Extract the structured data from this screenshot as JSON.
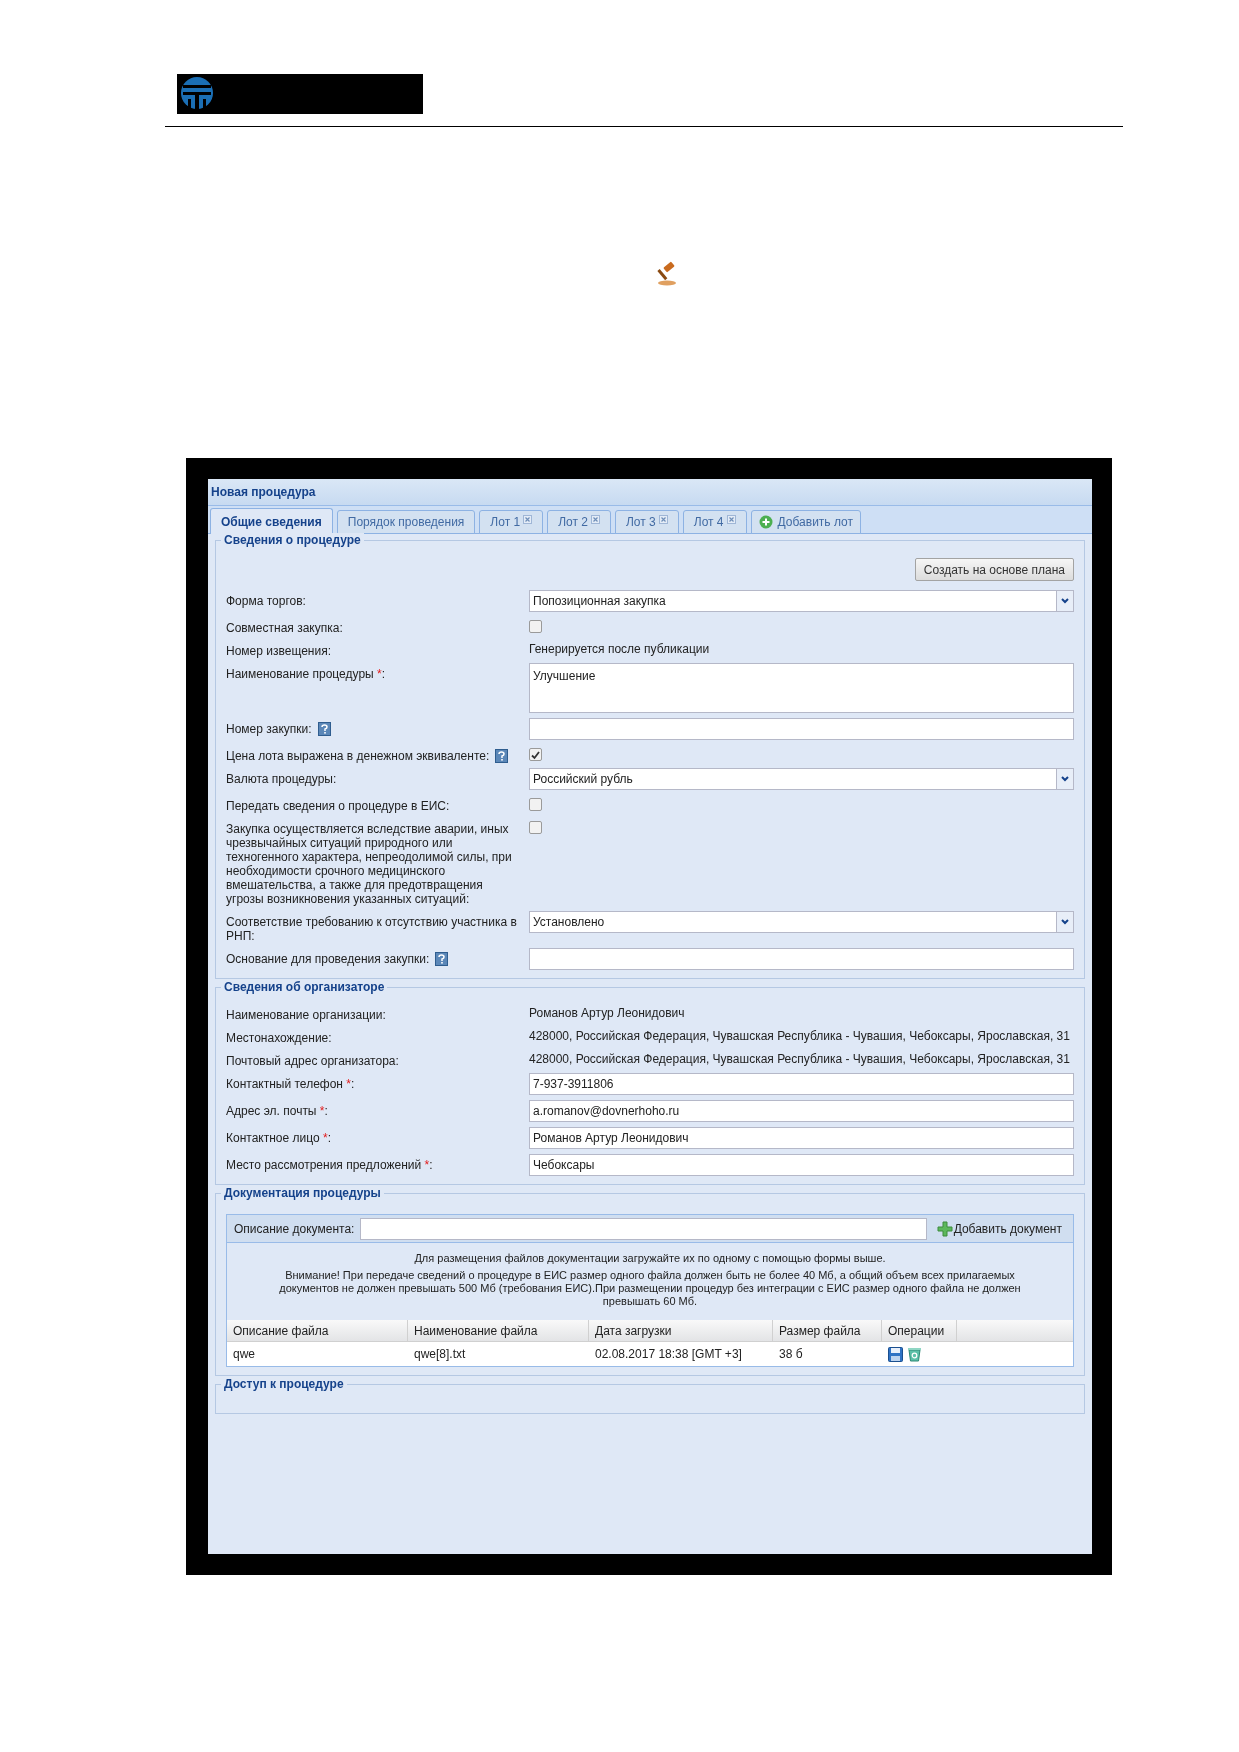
{
  "window": {
    "title": "Новая процедура"
  },
  "tabs": [
    {
      "label": "Общие сведения",
      "selected": true,
      "closable": false
    },
    {
      "label": "Порядок проведения",
      "selected": false,
      "closable": false
    },
    {
      "label": "Лот 1",
      "selected": false,
      "closable": true
    },
    {
      "label": "Лот 2",
      "selected": false,
      "closable": true
    },
    {
      "label": "Лот 3",
      "selected": false,
      "closable": true
    },
    {
      "label": "Лот 4",
      "selected": false,
      "closable": true
    }
  ],
  "add_tab": "Добавить лот",
  "sections": [
    {
      "kind": "form",
      "title": "Сведения о процедуре",
      "button": "Создать на основе плана",
      "rows": [
        {
          "kind": "select",
          "label": "Форма торгов:",
          "value": "Попозиционная закупка"
        },
        {
          "kind": "checkbox",
          "label": "Совместная закупка:",
          "checked": false
        },
        {
          "kind": "static",
          "label": "Номер извещения:",
          "value": "Генерируется после публикации"
        },
        {
          "kind": "textarea",
          "label": "Наименование процедуры ",
          "required_mark": "*",
          "label_end": ":",
          "value": "Улучшение"
        },
        {
          "kind": "input",
          "label": "Номер закупки:",
          "help": true
        },
        {
          "kind": "checkbox",
          "label": "Цена лота выражена в денежном эквиваленте:",
          "help": true,
          "checked": true
        },
        {
          "kind": "select",
          "label": "Валюта процедуры:",
          "value": "Российский рубль"
        },
        {
          "kind": "checkbox",
          "label": "Передать сведения о процедуре в ЕИС:",
          "checked": false
        },
        {
          "kind": "checkbox",
          "label": "Закупка осуществляется вследствие аварии, иных чрезвычайных ситуаций природного или техногенного характера, непреодолимой силы, при необходимости срочного медицинского вмешательства, а также для предотвращения угрозы возникновения указанных ситуаций:",
          "checked": false
        },
        {
          "kind": "select",
          "label": "Соответствие требованию к отсутствию участника в РНП:",
          "value": "Установлено"
        },
        {
          "kind": "input",
          "label": "Основание для проведения закупки:",
          "help": true
        }
      ]
    },
    {
      "kind": "form",
      "title": "Сведения об организаторе",
      "rows": [
        {
          "kind": "static",
          "label": "Наименование организации:",
          "value": "Романов Артур Леонидович"
        },
        {
          "kind": "static",
          "label": "Местонахождение:",
          "value": "428000, Российская Федерация, Чувашская Республика - Чувашия, Чебоксары, Ярославская, 31"
        },
        {
          "kind": "static",
          "label": "Почтовый адрес организатора:",
          "value": "428000, Российская Федерация, Чувашская Республика - Чувашия, Чебоксары, Ярославская, 31"
        },
        {
          "kind": "input",
          "label": "Контактный телефон ",
          "required_mark": "*",
          "label_end": ":",
          "value": "7-937-3911806"
        },
        {
          "kind": "input",
          "label": "Адрес эл. почты ",
          "required_mark": "*",
          "label_end": ":",
          "value": "a.romanov@dovnerhoho.ru"
        },
        {
          "kind": "input",
          "label": "Контактное лицо ",
          "required_mark": "*",
          "label_end": ":",
          "value": "Романов Артур Леонидович"
        },
        {
          "kind": "input",
          "label": "Место рассмотрения предложений ",
          "required_mark": "*",
          "label_end": ":",
          "value": "Чебоксары"
        }
      ]
    },
    {
      "kind": "documents",
      "title": "Документация процедуры",
      "description_label": "Описание документа:",
      "add_button": "Добавить документ",
      "notes": [
        "Для размещения файлов документации загружайте их по одному с помощью формы выше.",
        "Внимание! При передаче сведений о процедуре в ЕИС размер одного файла должен быть не более 40 Мб, а общий объем всех прилагаемых документов не должен превышать 500 Мб (требования ЕИС).При размещении процедур без интеграции с ЕИС размер одного файла не должен превышать 60 Мб."
      ],
      "table": {
        "columns": [
          "Описание файла",
          "Наименование файла",
          "Дата загрузки",
          "Размер файла",
          "Операции"
        ],
        "rows": [
          {
            "cells": [
              "qwe",
              "qwe[8].txt",
              "02.08.2017 18:38 [GMT +3]",
              "38 б"
            ]
          }
        ]
      }
    },
    {
      "kind": "cut",
      "title": "Доступ к процедуре"
    }
  ]
}
